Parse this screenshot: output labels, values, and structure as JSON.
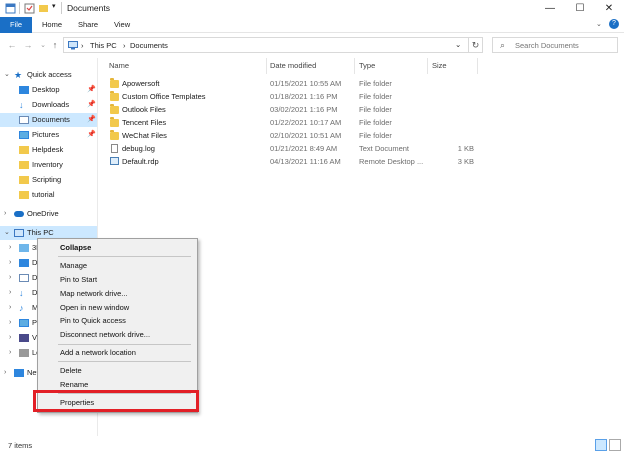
{
  "window": {
    "title": "Documents",
    "controls": {
      "minimize": "—",
      "maximize": "☐",
      "close": "✕"
    }
  },
  "ribbon": {
    "tabs": [
      "File",
      "Home",
      "Share",
      "View"
    ]
  },
  "address_bar": {
    "breadcrumb": [
      "This PC",
      "Documents"
    ],
    "search_placeholder": "Search Documents"
  },
  "nav_pane": {
    "quick_access": "Quick access",
    "items": [
      {
        "label": "Desktop",
        "icon": "desktop-icon",
        "pinned": true
      },
      {
        "label": "Downloads",
        "icon": "download-icon",
        "pinned": true
      },
      {
        "label": "Documents",
        "icon": "documents-icon",
        "pinned": true,
        "selected": true
      },
      {
        "label": "Pictures",
        "icon": "pictures-icon",
        "pinned": true
      },
      {
        "label": "Helpdesk",
        "icon": "folder-icon"
      },
      {
        "label": "Inventory",
        "icon": "folder-icon"
      },
      {
        "label": "Scripting",
        "icon": "folder-icon"
      },
      {
        "label": "tutorial",
        "icon": "folder-icon"
      }
    ],
    "onedrive": "OneDrive",
    "this_pc": "This PC",
    "this_pc_children": [
      "3D",
      "D",
      "D",
      "D",
      "M",
      "Pi",
      "Vi",
      "Lo"
    ],
    "network": "Net"
  },
  "file_list": {
    "columns": [
      "Name",
      "Date modified",
      "Type",
      "Size"
    ],
    "rows": [
      {
        "name": "Apowersoft",
        "date": "01/15/2021 10:55 AM",
        "type": "File folder",
        "size": "",
        "icon": "folder-icon"
      },
      {
        "name": "Custom Office Templates",
        "date": "01/18/2021 1:16 PM",
        "type": "File folder",
        "size": "",
        "icon": "folder-icon"
      },
      {
        "name": "Outlook Files",
        "date": "03/02/2021 1:16 PM",
        "type": "File folder",
        "size": "",
        "icon": "folder-icon"
      },
      {
        "name": "Tencent Files",
        "date": "01/22/2021 10:17 AM",
        "type": "File folder",
        "size": "",
        "icon": "folder-icon"
      },
      {
        "name": "WeChat Files",
        "date": "02/10/2021 10:51 AM",
        "type": "File folder",
        "size": "",
        "icon": "folder-icon"
      },
      {
        "name": "debug.log",
        "date": "01/21/2021 8:49 AM",
        "type": "Text Document",
        "size": "1 KB",
        "icon": "text-file-icon"
      },
      {
        "name": "Default.rdp",
        "date": "04/13/2021 11:16 AM",
        "type": "Remote Desktop ...",
        "size": "3 KB",
        "icon": "rdp-file-icon"
      }
    ]
  },
  "status_bar": {
    "item_count": "7 items"
  },
  "context_menu": {
    "items": [
      "Collapse",
      "Manage",
      "Pin to Start",
      "Map network drive...",
      "Open in new window",
      "Pin to Quick access",
      "Disconnect network drive...",
      "Add a network location",
      "Delete",
      "Rename",
      "Properties"
    ]
  },
  "colors": {
    "accent": "#1a6fc6",
    "selection": "#cce8ff",
    "highlight_border": "#e21f26"
  }
}
